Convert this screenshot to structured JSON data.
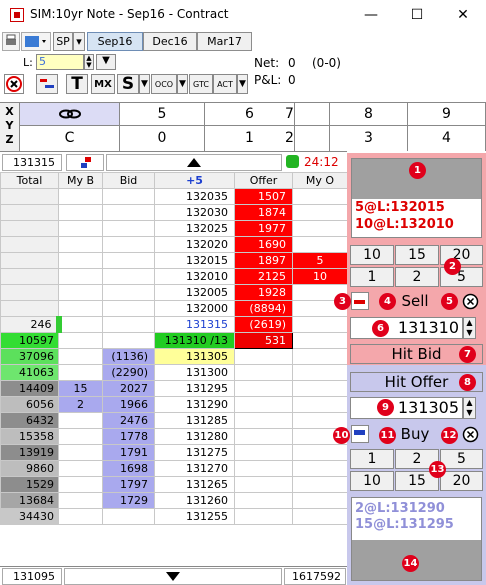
{
  "window": {
    "title": "SIM:10yr Note - Sep16 - Contract",
    "minimize": "—",
    "maximize": "☐",
    "close": "✕"
  },
  "toolbar": {
    "sp_label": "SP",
    "tabs": [
      "Sep16",
      "Dec16",
      "Mar17"
    ],
    "selected_tab": "Sep16"
  },
  "order_bar": {
    "l_label": "L:",
    "l_value": "5",
    "net_label": "Net:",
    "net_value": "0",
    "net_paren": "(0-0)",
    "pl_label": "P&L:",
    "pl_value": "0",
    "btn_t": "T",
    "btn_mx": "MX",
    "btn_s": "S",
    "btn_oco": "OCO",
    "btn_gtc": "GTC",
    "btn_act": "ACT"
  },
  "xyz": {
    "x": "X",
    "y": "Y",
    "z": "Z",
    "row1": [
      "",
      "5",
      "6",
      "7",
      "8",
      "9"
    ],
    "row2": [
      "C",
      "0",
      "1",
      "2",
      "3",
      "4"
    ]
  },
  "ladder_header": {
    "last_price": "131315",
    "timer": "24:12",
    "cols": [
      "Total",
      "My B",
      "Bid",
      "+5",
      "Offer",
      "My O"
    ]
  },
  "ladder_rows": [
    {
      "total": "",
      "myb": "",
      "bid": "",
      "price": "132035",
      "offer": "1507",
      "myo": ""
    },
    {
      "total": "",
      "myb": "",
      "bid": "",
      "price": "132030",
      "offer": "1874",
      "myo": ""
    },
    {
      "total": "",
      "myb": "",
      "bid": "",
      "price": "132025",
      "offer": "1977",
      "myo": ""
    },
    {
      "total": "",
      "myb": "",
      "bid": "",
      "price": "132020",
      "offer": "1690",
      "myo": ""
    },
    {
      "total": "",
      "myb": "",
      "bid": "",
      "price": "132015",
      "offer": "1897",
      "myo": "5"
    },
    {
      "total": "",
      "myb": "",
      "bid": "",
      "price": "132010",
      "offer": "2125",
      "myo": "10"
    },
    {
      "total": "",
      "myb": "",
      "bid": "",
      "price": "132005",
      "offer": "1928",
      "myo": ""
    },
    {
      "total": "",
      "myb": "",
      "bid": "",
      "price": "132000",
      "offer": "(8894)",
      "myo": ""
    },
    {
      "total": "246",
      "myb": "",
      "bid": "",
      "price": "131315",
      "offer": "(2619)",
      "myo": ""
    },
    {
      "total": "10597",
      "myb": "",
      "bid": "",
      "price": "131310 /13",
      "offer": "531",
      "myo": ""
    },
    {
      "total": "37096",
      "myb": "",
      "bid": "(1136)",
      "price": "131305",
      "offer": "",
      "myo": ""
    },
    {
      "total": "41063",
      "myb": "",
      "bid": "(2290)",
      "price": "131300",
      "offer": "",
      "myo": ""
    },
    {
      "total": "14409",
      "myb": "15",
      "bid": "2027",
      "price": "131295",
      "offer": "",
      "myo": ""
    },
    {
      "total": "6056",
      "myb": "2",
      "bid": "1966",
      "price": "131290",
      "offer": "",
      "myo": ""
    },
    {
      "total": "6432",
      "myb": "",
      "bid": "2476",
      "price": "131285",
      "offer": "",
      "myo": ""
    },
    {
      "total": "15358",
      "myb": "",
      "bid": "1778",
      "price": "131280",
      "offer": "",
      "myo": ""
    },
    {
      "total": "13919",
      "myb": "",
      "bid": "1791",
      "price": "131275",
      "offer": "",
      "myo": ""
    },
    {
      "total": "9860",
      "myb": "",
      "bid": "1698",
      "price": "131270",
      "offer": "",
      "myo": ""
    },
    {
      "total": "1529",
      "myb": "",
      "bid": "1797",
      "price": "131265",
      "offer": "",
      "myo": ""
    },
    {
      "total": "13684",
      "myb": "",
      "bid": "1729",
      "price": "131260",
      "offer": "",
      "myo": ""
    },
    {
      "total": "34430",
      "myb": "",
      "bid": "",
      "price": "131255",
      "offer": "",
      "myo": ""
    }
  ],
  "footer": {
    "left": "131095",
    "right": "1617592"
  },
  "sell_panel": {
    "orders": [
      "5@L:132015",
      "10@L:132010"
    ],
    "qty_row1": [
      "10",
      "15",
      "20"
    ],
    "qty_row2": [
      "1",
      "2",
      "5"
    ],
    "sell_label": "Sell",
    "price": "131310",
    "hit_bid": "Hit Bid"
  },
  "buy_panel": {
    "hit_offer": "Hit Offer",
    "price": "131305",
    "buy_label": "Buy",
    "qty_row1": [
      "1",
      "2",
      "5"
    ],
    "qty_row2": [
      "10",
      "15",
      "20"
    ],
    "orders": [
      "2@L:131290",
      "15@L:131295"
    ]
  },
  "callouts": [
    "1",
    "2",
    "3",
    "4",
    "5",
    "6",
    "7",
    "8",
    "9",
    "10",
    "11",
    "12",
    "13",
    "14"
  ],
  "colors": {
    "offer_red": "#ff0000",
    "bid_blue": "#a9a9ee",
    "green": "#33cc33",
    "yellow": "#ffff99",
    "gray": "#a0a0a0"
  }
}
